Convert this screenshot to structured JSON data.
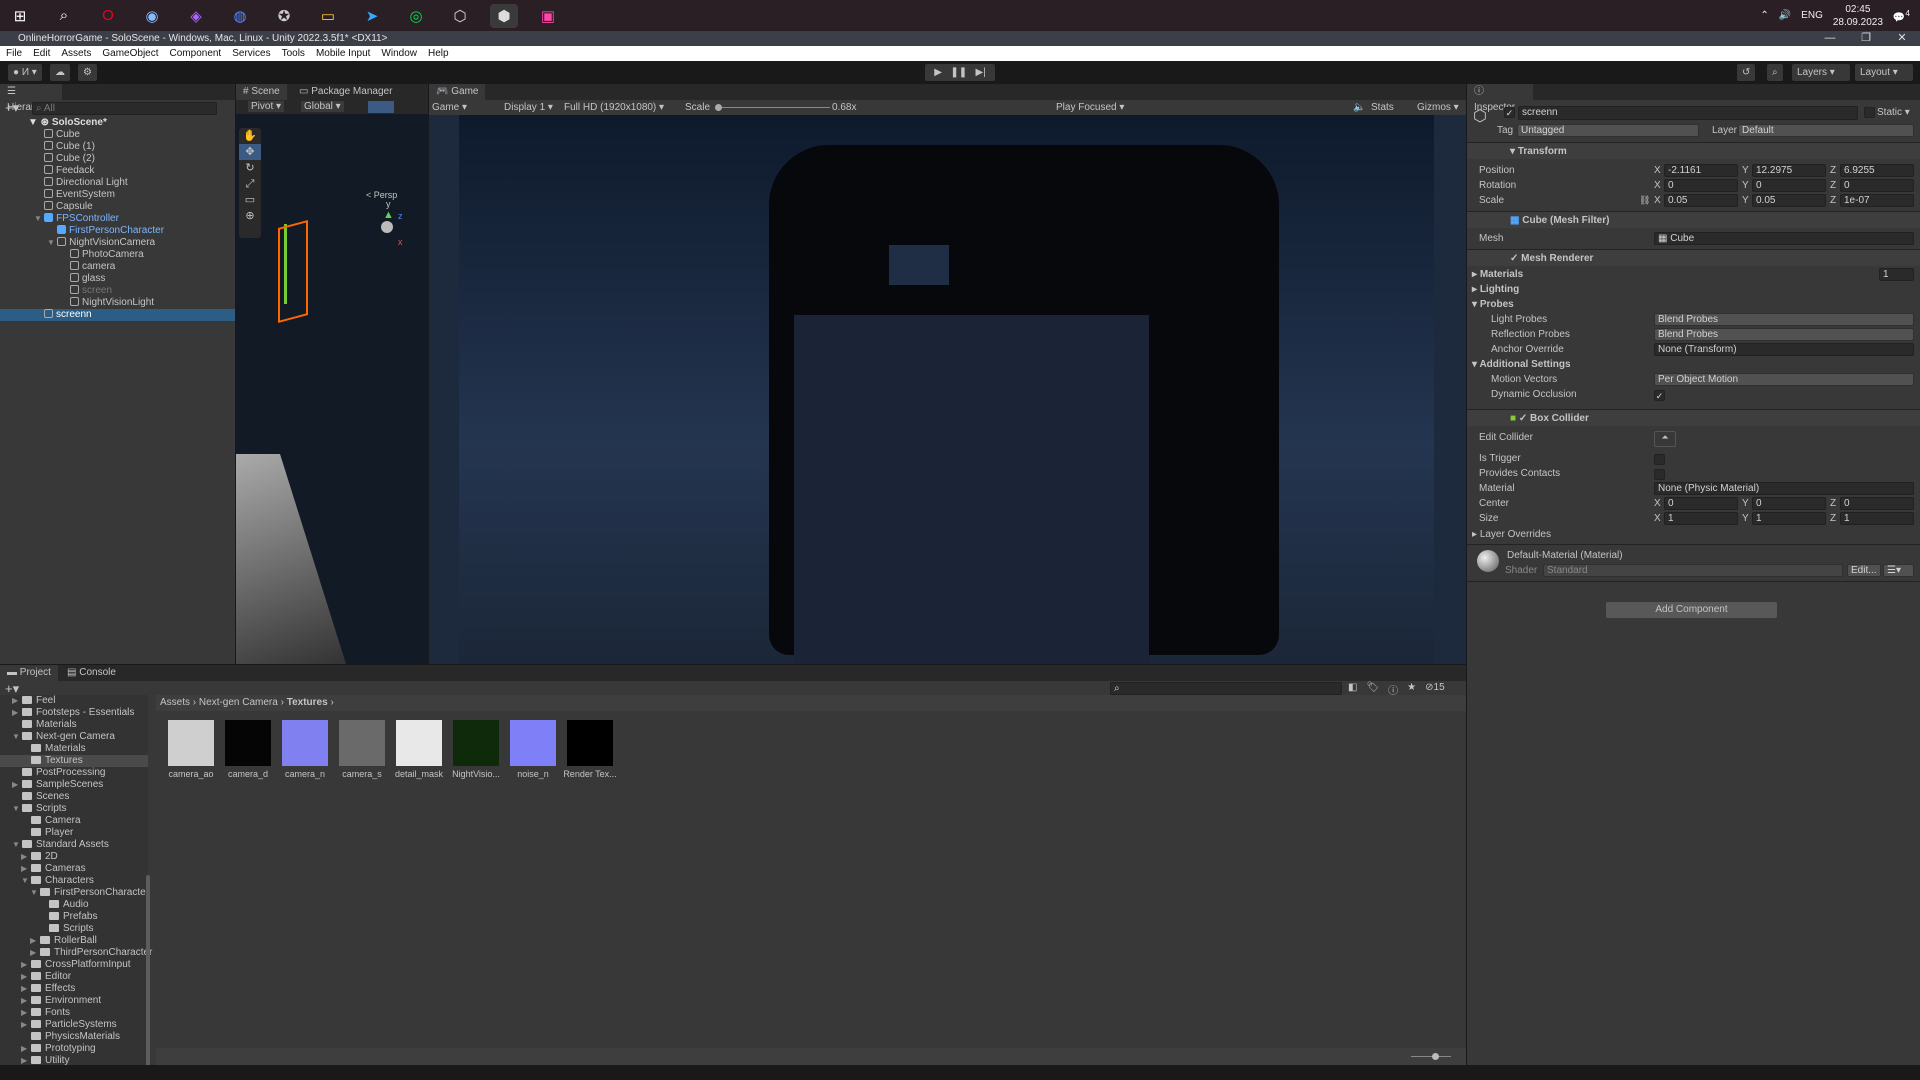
{
  "taskbar": {
    "icons": [
      "windows-icon",
      "search-icon",
      "opera-icon",
      "steam-icon",
      "visual-studio-icon",
      "discord-icon",
      "xbox-icon",
      "file-explorer-icon",
      "telegram-icon",
      "spotify-icon",
      "unity-hub-icon",
      "unity-icon",
      "rider-icon"
    ],
    "badges": {
      "discord": "9+",
      "telegram": "85"
    },
    "tray": {
      "language": "ENG",
      "time": "02:45",
      "date": "28.09.2023",
      "notifications": "4"
    }
  },
  "window": {
    "title": "OnlineHorrorGame - SoloScene - Windows, Mac, Linux - Unity 2022.3.5f1* <DX11>"
  },
  "menu": [
    "File",
    "Edit",
    "Assets",
    "GameObject",
    "Component",
    "Services",
    "Tools",
    "Mobile Input",
    "Window",
    "Help"
  ],
  "toolbar": {
    "account": "И",
    "layers": "Layers",
    "layout": "Layout"
  },
  "hierarchy": {
    "tab": "Hierarchy",
    "search_placeholder": "All",
    "scene": "SoloScene*",
    "items": [
      {
        "label": "Cube",
        "depth": 0
      },
      {
        "label": "Cube (1)",
        "depth": 0
      },
      {
        "label": "Cube (2)",
        "depth": 0
      },
      {
        "label": "Feedack",
        "depth": 0
      },
      {
        "label": "Directional Light",
        "depth": 0
      },
      {
        "label": "EventSystem",
        "depth": 0
      },
      {
        "label": "Capsule",
        "depth": 0
      },
      {
        "label": "FPSController",
        "depth": 0,
        "prefab": true
      },
      {
        "label": "FirstPersonCharacter",
        "depth": 1,
        "prefab": true
      },
      {
        "label": "NightVisionCamera",
        "depth": 1
      },
      {
        "label": "PhotoCamera",
        "depth": 2
      },
      {
        "label": "camera",
        "depth": 2
      },
      {
        "label": "glass",
        "depth": 2
      },
      {
        "label": "screen",
        "depth": 2,
        "disabled": true
      },
      {
        "label": "NightVisionLight",
        "depth": 2
      },
      {
        "label": "screenn",
        "depth": 0,
        "selected": true
      }
    ]
  },
  "scene": {
    "tab": "Scene",
    "tab2": "Package Manager",
    "pivot": "Pivot",
    "global": "Global",
    "persp": "Persp",
    "axis": {
      "x": "x",
      "y": "y",
      "z": "z"
    }
  },
  "game": {
    "tab": "Game",
    "mode": "Game",
    "display": "Display 1",
    "resolution": "Full HD (1920x1080)",
    "scale_label": "Scale",
    "scale": "0.68x",
    "play_focused": "Play Focused",
    "stats": "Stats",
    "gizmos": "Gizmos"
  },
  "inspector": {
    "tab": "Inspector",
    "name": "screenn",
    "static": "Static",
    "tag_label": "Tag",
    "tag": "Untagged",
    "layer_label": "Layer",
    "layer": "Default",
    "transform": {
      "title": "Transform",
      "position_label": "Position",
      "rotation_label": "Rotation",
      "scale_label": "Scale",
      "position": [
        "-2.1161",
        "12.2975",
        "6.9255"
      ],
      "rotation": [
        "0",
        "0",
        "0"
      ],
      "scale": [
        "0.05",
        "0.05",
        "1e-07"
      ]
    },
    "mesh_filter": {
      "title": "Cube (Mesh Filter)",
      "mesh_label": "Mesh",
      "mesh": "Cube"
    },
    "mesh_renderer": {
      "title": "Mesh Renderer",
      "materials": "Materials",
      "materials_count": "1",
      "lighting": "Lighting",
      "probes": "Probes",
      "light_probes_label": "Light Probes",
      "light_probes": "Blend Probes",
      "reflection_probes_label": "Reflection Probes",
      "reflection_probes": "Blend Probes",
      "anchor_label": "Anchor Override",
      "anchor": "None (Transform)",
      "additional": "Additional Settings",
      "motion_label": "Motion Vectors",
      "motion": "Per Object Motion",
      "dynamic_occlusion_label": "Dynamic Occlusion"
    },
    "box_collider": {
      "title": "Box Collider",
      "edit_label": "Edit Collider",
      "is_trigger": "Is Trigger",
      "provides_contacts": "Provides Contacts",
      "material_label": "Material",
      "material": "None (Physic Material)",
      "center_label": "Center",
      "center": [
        "0",
        "0",
        "0"
      ],
      "size_label": "Size",
      "size": [
        "1",
        "1",
        "1"
      ],
      "layer_overrides": "Layer Overrides"
    },
    "material": {
      "title": "Default-Material (Material)",
      "shader_label": "Shader",
      "shader": "Standard",
      "edit": "Edit..."
    },
    "add_component": "Add Component",
    "axes": [
      "X",
      "Y",
      "Z"
    ]
  },
  "project": {
    "tab": "Project",
    "tab2": "Console",
    "hidden_count": "15",
    "breadcrumb": [
      "Assets",
      "Next-gen Camera",
      "Textures"
    ],
    "tree": [
      {
        "label": "Feel",
        "d": 0,
        "a": "▶"
      },
      {
        "label": "Footsteps - Essentials",
        "d": 0,
        "a": "▶"
      },
      {
        "label": "Materials",
        "d": 0,
        "a": ""
      },
      {
        "label": "Next-gen Camera",
        "d": 0,
        "a": "▼"
      },
      {
        "label": "Materials",
        "d": 1,
        "a": ""
      },
      {
        "label": "Textures",
        "d": 1,
        "a": "",
        "sel": true
      },
      {
        "label": "PostProcessing",
        "d": 0,
        "a": ""
      },
      {
        "label": "SampleScenes",
        "d": 0,
        "a": "▶"
      },
      {
        "label": "Scenes",
        "d": 0,
        "a": ""
      },
      {
        "label": "Scripts",
        "d": 0,
        "a": "▼"
      },
      {
        "label": "Camera",
        "d": 1,
        "a": ""
      },
      {
        "label": "Player",
        "d": 1,
        "a": ""
      },
      {
        "label": "Standard Assets",
        "d": 0,
        "a": "▼"
      },
      {
        "label": "2D",
        "d": 1,
        "a": "▶"
      },
      {
        "label": "Cameras",
        "d": 1,
        "a": "▶"
      },
      {
        "label": "Characters",
        "d": 1,
        "a": "▼"
      },
      {
        "label": "FirstPersonCharacter",
        "d": 2,
        "a": "▼"
      },
      {
        "label": "Audio",
        "d": 3,
        "a": ""
      },
      {
        "label": "Prefabs",
        "d": 3,
        "a": ""
      },
      {
        "label": "Scripts",
        "d": 3,
        "a": ""
      },
      {
        "label": "RollerBall",
        "d": 2,
        "a": "▶"
      },
      {
        "label": "ThirdPersonCharacter",
        "d": 2,
        "a": "▶"
      },
      {
        "label": "CrossPlatformInput",
        "d": 1,
        "a": "▶"
      },
      {
        "label": "Editor",
        "d": 1,
        "a": "▶"
      },
      {
        "label": "Effects",
        "d": 1,
        "a": "▶"
      },
      {
        "label": "Environment",
        "d": 1,
        "a": "▶"
      },
      {
        "label": "Fonts",
        "d": 1,
        "a": "▶"
      },
      {
        "label": "ParticleSystems",
        "d": 1,
        "a": "▶"
      },
      {
        "label": "PhysicsMaterials",
        "d": 1,
        "a": ""
      },
      {
        "label": "Prototyping",
        "d": 1,
        "a": "▶"
      },
      {
        "label": "Utility",
        "d": 1,
        "a": "▶"
      }
    ],
    "assets": [
      {
        "label": "camera_ao",
        "color": "#cfcfcf"
      },
      {
        "label": "camera_d",
        "color": "#050505"
      },
      {
        "label": "camera_n",
        "color": "#8080f0"
      },
      {
        "label": "camera_s",
        "color": "#6a6a6a"
      },
      {
        "label": "detail_mask",
        "color": "#e8e8e8"
      },
      {
        "label": "NightVisio...",
        "color": "#0f2a0a"
      },
      {
        "label": "noise_n",
        "color": "#7f7ff8"
      },
      {
        "label": "Render Tex...",
        "color": "#000000"
      }
    ]
  }
}
